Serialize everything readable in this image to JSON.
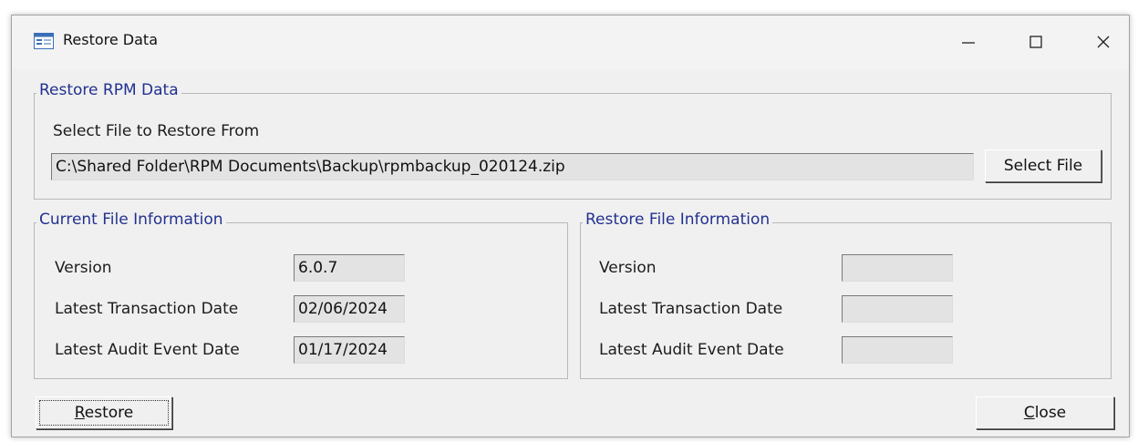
{
  "window": {
    "title": "Restore Data",
    "icon": "form-icon",
    "controls": {
      "minimize": "minimize-icon",
      "maximize": "maximize-icon",
      "close": "close-icon"
    }
  },
  "restore_group": {
    "legend": "Restore RPM Data",
    "select_label": "Select File to Restore From",
    "file_path": "C:\\Shared Folder\\RPM Documents\\Backup\\rpmbackup_020124.zip",
    "select_button": "Select File"
  },
  "current_info": {
    "legend": "Current File Information",
    "version_label": "Version",
    "version_value": "6.0.7",
    "transaction_label": "Latest Transaction Date",
    "transaction_value": "02/06/2024",
    "audit_label": "Latest Audit Event Date",
    "audit_value": "01/17/2024"
  },
  "restore_info": {
    "legend": "Restore File Information",
    "version_label": "Version",
    "version_value": "",
    "transaction_label": "Latest Transaction Date",
    "transaction_value": "",
    "audit_label": "Latest Audit Event Date",
    "audit_value": ""
  },
  "buttons": {
    "restore_mnemonic": "R",
    "restore_rest": "estore",
    "close_mnemonic": "C",
    "close_rest": "lose"
  },
  "colors": {
    "legend": "#22318f",
    "window_bg": "#f0f0f0",
    "textbox_bg": "#e3e3e3"
  }
}
